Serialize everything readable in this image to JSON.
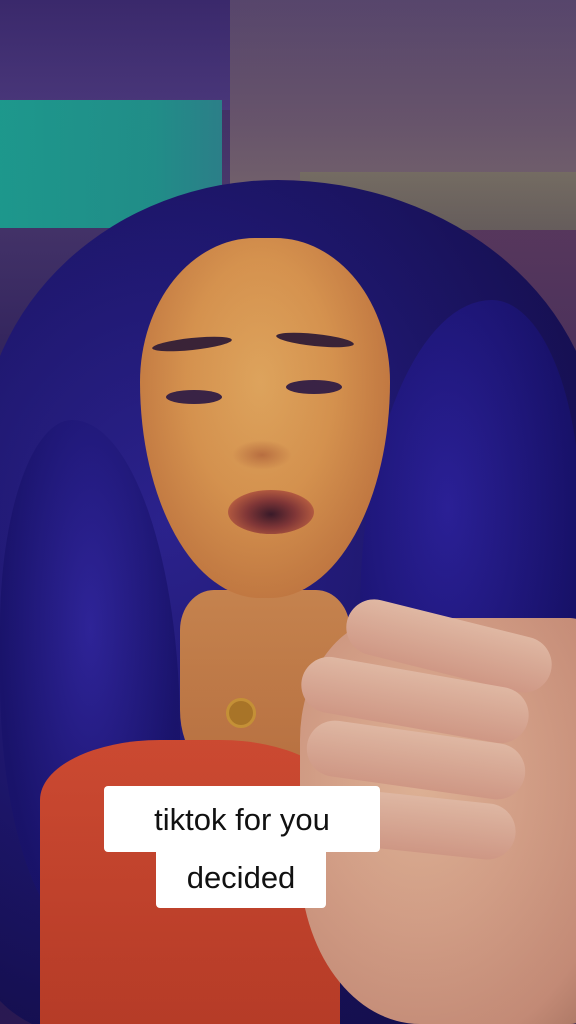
{
  "caption": {
    "line1": "tiktok for you",
    "line2": "decided"
  },
  "colors": {
    "caption_bg": "#ffffff",
    "caption_text": "#111111",
    "teal_panel": "#1aa68f",
    "shirt": "#e0502a",
    "hair": "#1c176e"
  }
}
